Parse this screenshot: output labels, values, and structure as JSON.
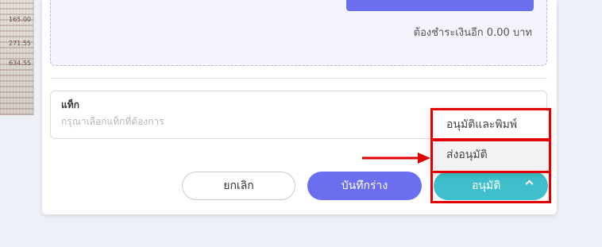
{
  "receipt": {
    "amounts": [
      "165.00",
      "271.55",
      "634.55"
    ]
  },
  "payment": {
    "remaining_text": "ต้องชำระเงินอีก 0.00 บาท"
  },
  "tag_field": {
    "label": "แท็ก",
    "placeholder": "กรุณาเลือกแท็กที่ต้องการ"
  },
  "actions": {
    "cancel_label": "ยกเลิก",
    "draft_label": "บันทึกร่าง",
    "approve_label": "อนุมัติ"
  },
  "approve_menu": {
    "items": [
      {
        "label": "อนุมัติและพิมพ์"
      },
      {
        "label": "ส่งอนุมัติ"
      }
    ]
  },
  "colors": {
    "primary": "#6c6ef0",
    "approve": "#3fbfcc",
    "highlight": "#e00000"
  }
}
